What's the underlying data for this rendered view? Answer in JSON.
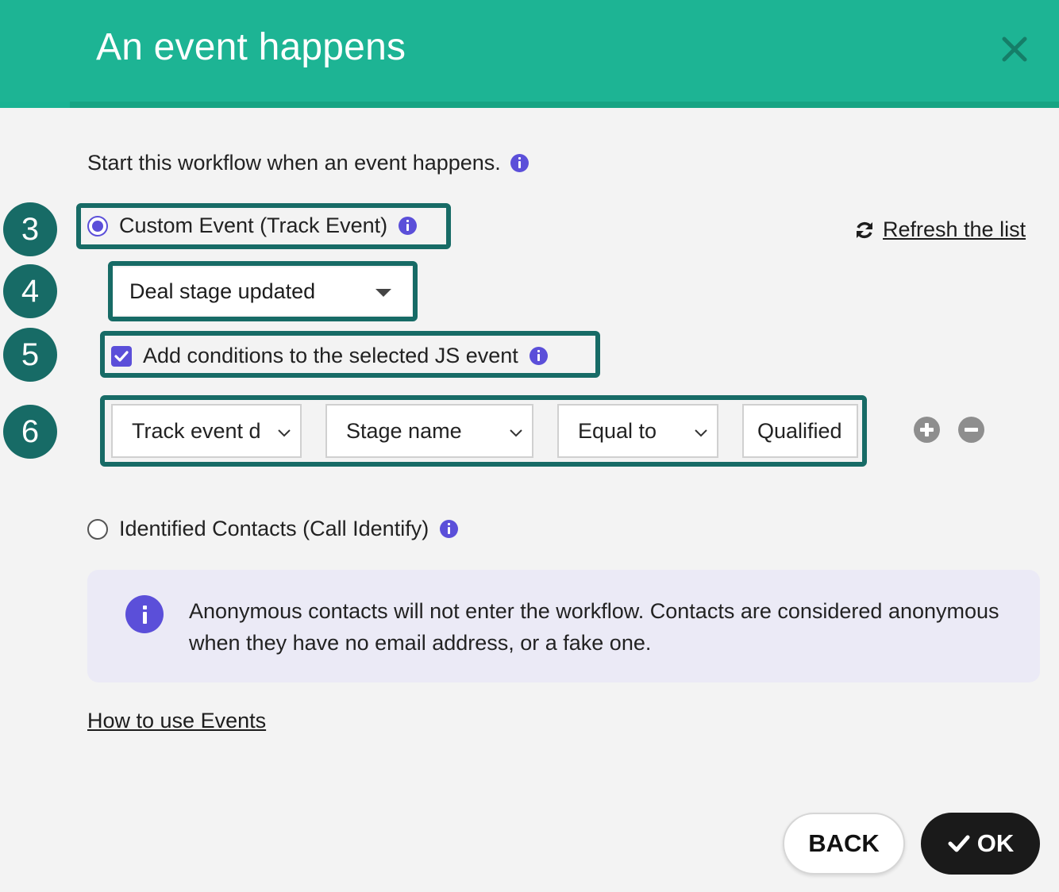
{
  "header": {
    "title": "An event happens",
    "close_icon": "close-icon"
  },
  "intro": {
    "text": "Start this workflow when an event happens."
  },
  "steps": [
    "3",
    "4",
    "5",
    "6"
  ],
  "custom_event": {
    "label": "Custom Event (Track Event)",
    "selected": true
  },
  "refresh": {
    "label": "Refresh the list",
    "icon": "refresh-icon"
  },
  "event_dropdown": {
    "value": "Deal stage updated"
  },
  "conditions": {
    "label": "Add conditions to the selected JS event",
    "checked": true
  },
  "condition_row": {
    "field": "Track event d",
    "property": "Stage name",
    "operator": "Equal to",
    "value": "Qualified"
  },
  "identified": {
    "label": "Identified Contacts (Call Identify)",
    "selected": false
  },
  "notice": {
    "text": "Anonymous contacts will not enter the workflow. Contacts are considered anonymous when they have no email address, or a fake one."
  },
  "help_link": "How to use Events",
  "buttons": {
    "back": "BACK",
    "ok": "OK"
  },
  "colors": {
    "header": "#1db494",
    "step_badge": "#176b66",
    "accent": "#5b4fd9"
  }
}
